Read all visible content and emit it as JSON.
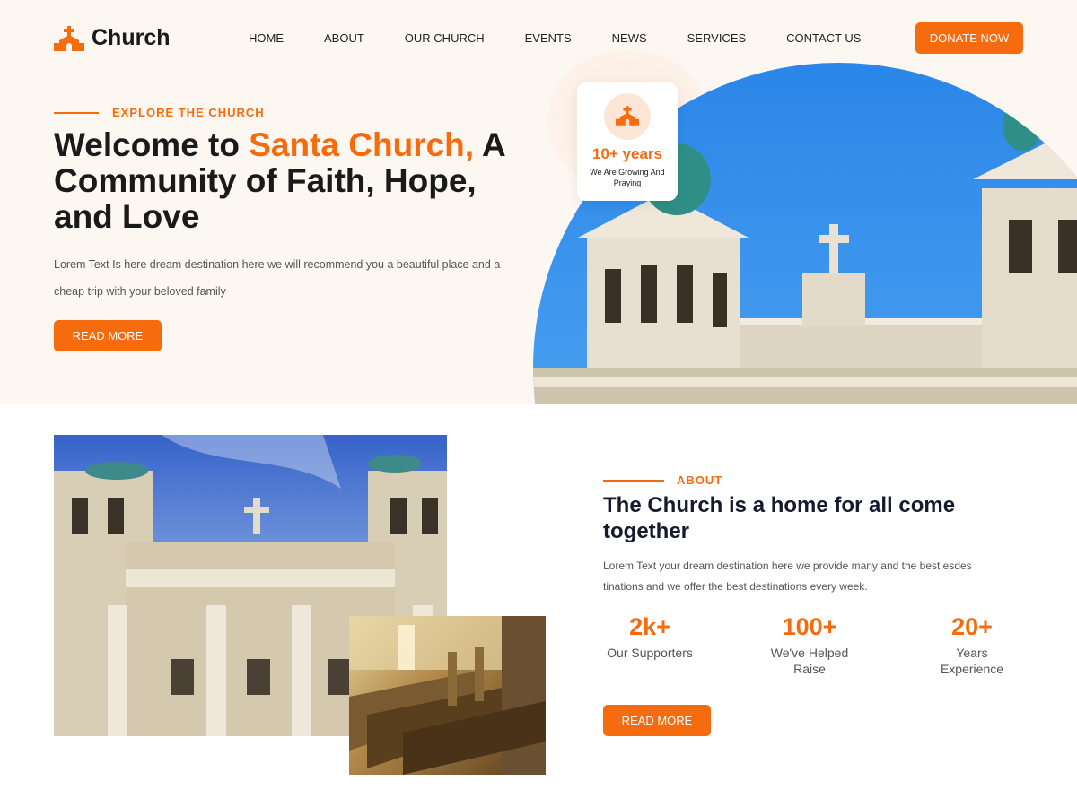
{
  "header": {
    "logo_text": "Church",
    "nav": [
      "HOME",
      "ABOUT",
      "OUR CHURCH",
      "EVENTS",
      "NEWS",
      "SERVICES",
      "CONTACT US"
    ],
    "donate_label": "DONATE NOW"
  },
  "hero": {
    "eyebrow": "EXPLORE THE CHURCH",
    "title_before": "Welcome to ",
    "title_accent": "Santa Church,",
    "title_after": " A Community of Faith, Hope, and Love",
    "description": "Lorem Text Is here  dream destination here we will recommend you a beautiful place and a cheap trip with your beloved family",
    "button_label": "READ MORE",
    "years_card": {
      "value": "10+ years",
      "label": "We Are Growing And Praying"
    }
  },
  "about": {
    "eyebrow": "ABOUT",
    "title": "The Church is a home for all come together",
    "description": "Lorem Text  your dream destination here we provide many  and the best esdes tinations and we offer the best destinations every week.",
    "stats": [
      {
        "value": "2k+",
        "label": "Our Supporters"
      },
      {
        "value": "100+",
        "label": "We've Helped Raise"
      },
      {
        "value": "20+",
        "label": "Years Experience"
      }
    ],
    "button_label": "READ MORE"
  },
  "colors": {
    "accent": "#f76b0f",
    "hero_bg": "#fdf7f1",
    "heading": "#161a2e"
  },
  "icons": {
    "logo": "church-icon",
    "years_card": "church-icon"
  }
}
